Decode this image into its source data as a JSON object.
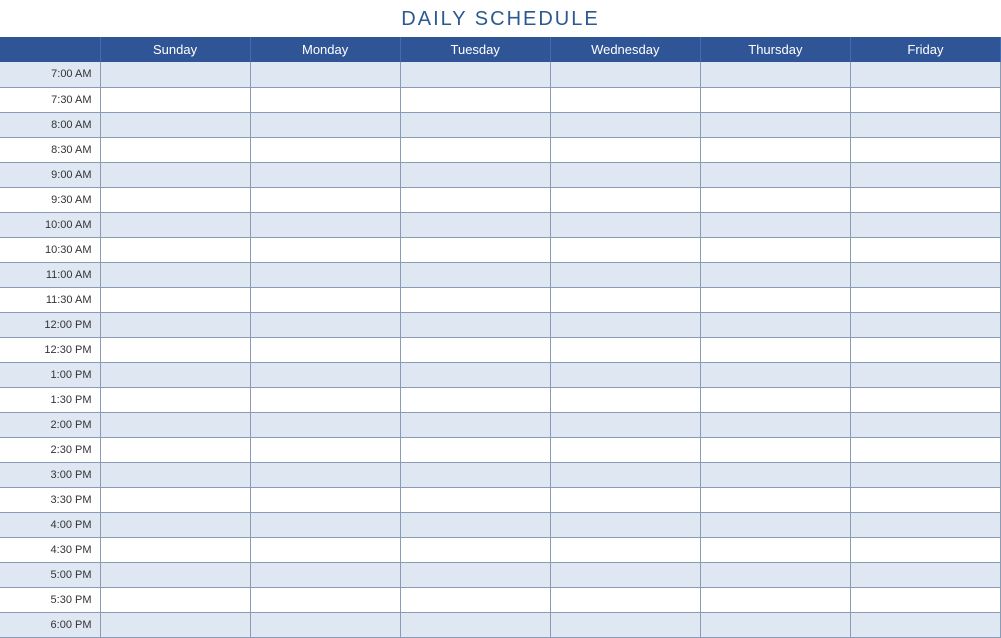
{
  "title": "DAILY SCHEDULE",
  "days": [
    "Sunday",
    "Monday",
    "Tuesday",
    "Wednesday",
    "Thursday",
    "Friday"
  ],
  "times": [
    "7:00 AM",
    "7:30 AM",
    "8:00 AM",
    "8:30 AM",
    "9:00 AM",
    "9:30 AM",
    "10:00 AM",
    "10:30 AM",
    "11:00 AM",
    "11:30 AM",
    "12:00 PM",
    "12:30 PM",
    "1:00 PM",
    "1:30 PM",
    "2:00 PM",
    "2:30 PM",
    "3:00 PM",
    "3:30 PM",
    "4:00 PM",
    "4:30 PM",
    "5:00 PM",
    "5:30 PM",
    "6:00 PM"
  ]
}
